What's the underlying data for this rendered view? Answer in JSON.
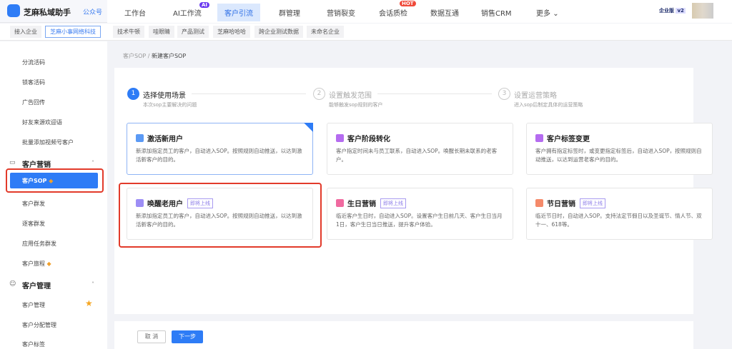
{
  "header": {
    "brand": "芝麻私域助手",
    "account_type": "公众号",
    "nav": [
      {
        "label": "工作台"
      },
      {
        "label": "AI工作流",
        "badge": "AI"
      },
      {
        "label": "客户引流",
        "active": true
      },
      {
        "label": "群管理"
      },
      {
        "label": "营销裂变"
      },
      {
        "label": "会话质检",
        "badge": "HOT"
      },
      {
        "label": "数据互通"
      },
      {
        "label": "销售CRM"
      },
      {
        "label": "更多"
      }
    ],
    "edition": "企业版",
    "version": "v2"
  },
  "tabs": [
    "接入企业",
    "芝麻小事网络科技",
    "技术牛顿",
    "哇眼睛",
    "产品测试",
    "芝麻哈哈哈",
    "跨企业测试数据",
    "未命名企业"
  ],
  "sidebar": {
    "items_top": [
      "分流活码",
      "锁客活码",
      "广告回传",
      "好友来源欢迎语",
      "批量添加视频号客户"
    ],
    "group1": "客户营销",
    "group1_items": [
      "客户SOP",
      "客户群发",
      "逐客群发",
      "应用任务群发",
      "客户旅程"
    ],
    "group2": "客户管理",
    "group2_items": [
      "客户管理",
      "客户分配管理",
      "客户标签"
    ]
  },
  "breadcrumb": {
    "parent": "客户SOP",
    "current": "新建客户SOP"
  },
  "steps": [
    {
      "num": "1",
      "title": "选择使用场景",
      "desc": "本次sop主要解决的问题"
    },
    {
      "num": "2",
      "title": "设置触发范围",
      "desc": "能够触发sop规则的客户"
    },
    {
      "num": "3",
      "title": "设置运营策略",
      "desc": "进入sop后制定具体的运营策略"
    }
  ],
  "coming_soon": "即将上线",
  "cards": [
    {
      "title": "激活新用户",
      "desc": "新添加指定员工的客户，自动进入SOP。按照规则自动推送，以达到激活新客户的目的。",
      "color": "#5b9af5"
    },
    {
      "title": "客户阶段转化",
      "desc": "客户指定时间未与员工联系，自动进入SOP。唤醒长期未联系的老客户。",
      "color": "#b56cf0"
    },
    {
      "title": "客户标签变更",
      "desc": "客户拥有指定标签时，或变更指定标签后，自动进入SOP，按照规则自动推送，以达到运营老客户的目的。",
      "color": "#b56cf0"
    },
    {
      "title": "唤醒老用户",
      "desc": "新添加指定员工的客户，自动进入SOP。按照规则自动推送，以达到激活新客户的目的。",
      "color": "#9d8ef5"
    },
    {
      "title": "生日营销",
      "desc": "临近客户生日时，自动进入SOP。设置客户生日前几天、客户生日当月1日，客户生日当日推送，提升客户体验。",
      "color": "#f06aa0"
    },
    {
      "title": "节日营销",
      "desc": "临近节日时，自动进入SOP。支持法定节假日以及圣诞节、情人节、双十一、618等。",
      "color": "#f58a6a"
    }
  ],
  "footer": {
    "cancel": "取 消",
    "next": "下一步"
  }
}
